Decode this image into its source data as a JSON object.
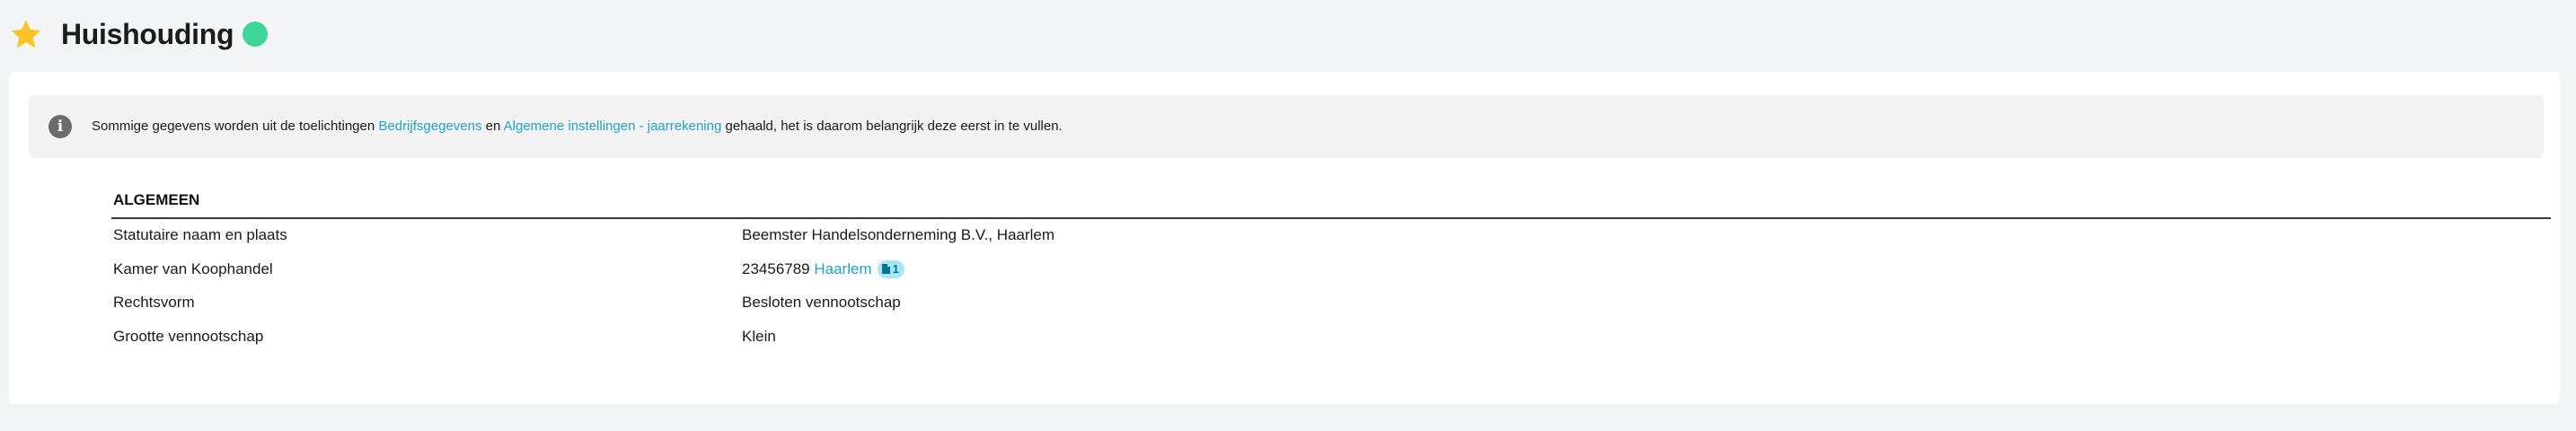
{
  "header": {
    "title": "Huishouding",
    "star_color": "#f7c325",
    "status_color": "#3dd598"
  },
  "info": {
    "text_before": "Sommige gegevens worden uit de toelichtingen ",
    "link1": "Bedrijfsgegevens",
    "text_middle": " en ",
    "link2": "Algemene instellingen - jaarrekening",
    "text_after": " gehaald, het is daarom belangrijk deze eerst in te vullen."
  },
  "section": {
    "title": "ALGEMEEN",
    "rows": [
      {
        "label": "Statutaire naam en plaats",
        "value": "Beemster Handelsonderneming B.V., Haarlem"
      },
      {
        "label": "Kamer van Koophandel",
        "value": "23456789",
        "link": "Haarlem",
        "badge_count": "1"
      },
      {
        "label": "Rechtsvorm",
        "value": "Besloten vennootschap"
      },
      {
        "label": "Grootte vennootschap",
        "value": "Klein"
      }
    ]
  },
  "colors": {
    "link": "#1ba3c9",
    "badge_bg": "#a6e6f5",
    "page_bg": "#f3f4f6"
  }
}
